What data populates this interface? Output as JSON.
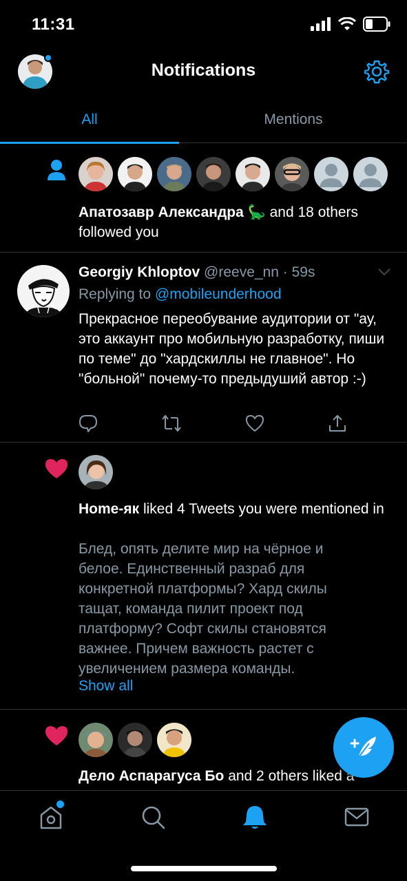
{
  "status": {
    "time": "11:31"
  },
  "header": {
    "title": "Notifications"
  },
  "tabs": [
    {
      "label": "All"
    },
    {
      "label": "Mentions"
    }
  ],
  "follow": {
    "name": "Апатозавр Александра",
    "emoji": "🦕",
    "suffix": "and 18 others",
    "action": "followed you"
  },
  "tweet": {
    "author": "Georgiy Khloptov",
    "handle": "@reeve_nn",
    "time": "· 59s",
    "replying_prefix": "Replying to",
    "replying_handle": "@mobileunderhood",
    "text": "Прекрасное переобувание аудитории от \"ау, это аккаунт про мобильную разработку, пиши по теме\" до \"хардскиллы не главное\". Но \"больной\" почему-то предыдуший автор :-)"
  },
  "like1": {
    "name": "Home-як",
    "action": "liked 4 Tweets you were mentioned in",
    "preview": "Блед, опять делите мир на чёрное и белое. Единственный разраб для конкретной платформы? Хард скилы тащат, команда пилит проект под платформу? Софт скилы становятся важнее. Причем важность растет с увеличением размера команды.",
    "show_all": "Show all"
  },
  "like2": {
    "name": "Дело Аспарагуса Бо",
    "action": "and 2 others liked a"
  },
  "colors": {
    "accent": "#1da1f2",
    "like": "#e0245e",
    "muted": "#8899a6",
    "border": "#2f3336"
  }
}
